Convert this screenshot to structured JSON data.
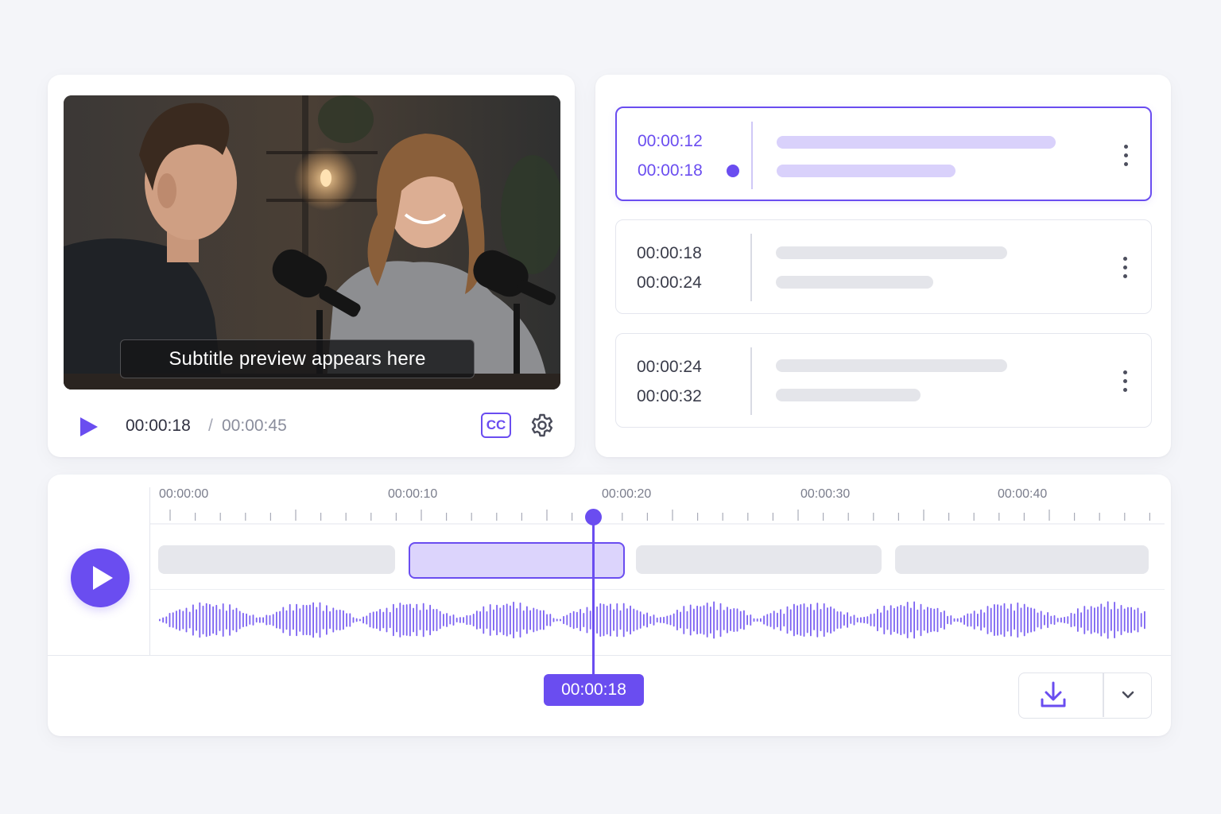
{
  "colors": {
    "accent": "#6a4df0",
    "accent_soft": "#dcd4fc",
    "bar_gray": "#e4e5ea",
    "background": "#f4f5f9"
  },
  "player": {
    "subtitle_preview": "Subtitle preview appears here",
    "current_time": "00:00:18",
    "separator": "/",
    "total_time": "00:00:45",
    "cc_label": "CC",
    "icons": [
      "play-icon",
      "cc-icon",
      "gear-icon"
    ]
  },
  "segments": [
    {
      "start": "00:00:12",
      "end": "00:00:18",
      "active": true
    },
    {
      "start": "00:00:18",
      "end": "00:00:24",
      "active": false
    },
    {
      "start": "00:00:24",
      "end": "00:00:32",
      "active": false
    }
  ],
  "timeline": {
    "ruler_labels": [
      "00:00:00",
      "00:00:10",
      "00:00:20",
      "00:00:30",
      "00:00:40"
    ],
    "playhead_time": "00:00:18",
    "icons": [
      "play-icon",
      "download-icon",
      "chevron-down-icon"
    ]
  }
}
